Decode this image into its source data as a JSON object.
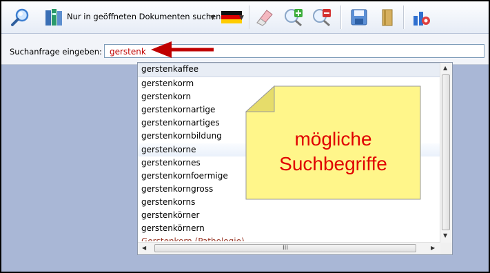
{
  "toolbar": {
    "search_only_open_docs_label": "Nur in geöffneten Dokumenten suchen",
    "icons": [
      "magnifier-icon",
      "books-icon",
      "flag-germany-icon",
      "eraser-icon",
      "zoom-in-icon",
      "zoom-out-icon",
      "save-icon",
      "book-icon",
      "settings-icon"
    ]
  },
  "search": {
    "label": "Suchanfrage eingeben:",
    "value": "gerstenk",
    "text_color": "#c00000"
  },
  "suggestions": {
    "items": [
      "gerstenkaffee",
      "gerstenkorm",
      "gerstenkorn",
      "gerstenkornartige",
      "gerstenkornartiges",
      "gerstenkornbildung",
      "gerstenkorne",
      "gerstenkornes",
      "gerstenkornfoermige",
      "gerstenkorngross",
      "gerstenkorns",
      "gerstenkörner",
      "gerstenkörnern",
      "Gerstenkorn (Pathologie)"
    ],
    "highlighted_index": 0,
    "selected_index": 6,
    "hscroll_grip": "III"
  },
  "annotation": {
    "text": "mögliche\nSuchbegriffe",
    "text_color": "#e00000",
    "note_color": "#fff68a",
    "arrow_color": "#c00000"
  }
}
